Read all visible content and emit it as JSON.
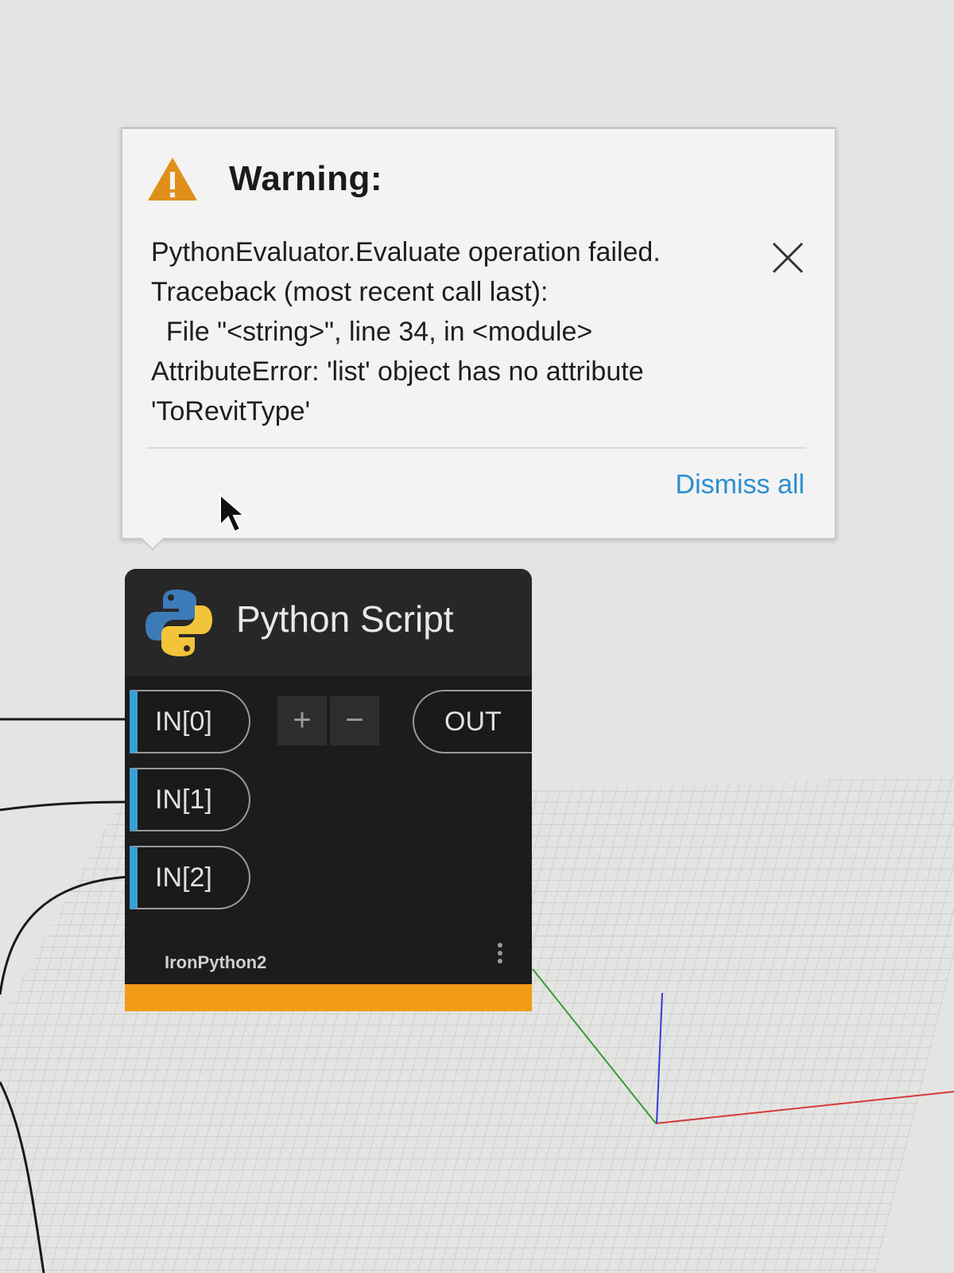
{
  "warning": {
    "title": "Warning:",
    "message_lines": [
      "PythonEvaluator.Evaluate operation failed.",
      "Traceback (most recent call last):",
      "  File \"<string>\", line 34, in <module>",
      "AttributeError: 'list' object has no attribute",
      "'ToRevitType'"
    ],
    "dismiss_all_label": "Dismiss all",
    "icon": "warning-triangle-icon",
    "accent_color": "#e0901a"
  },
  "node": {
    "title": "Python Script",
    "inputs": [
      "IN[0]",
      "IN[1]",
      "IN[2]"
    ],
    "add_port_label": "+",
    "remove_port_label": "−",
    "output": "OUT",
    "engine": "IronPython2",
    "header_color": "#272727",
    "footer_color": "#f29b16",
    "port_accent_color": "#3aa0d8"
  },
  "colors": {
    "link": "#2d8fd0",
    "x_axis": "#d43a3a",
    "y_axis": "#3a9a3a",
    "z_axis": "#3a3ad4"
  }
}
